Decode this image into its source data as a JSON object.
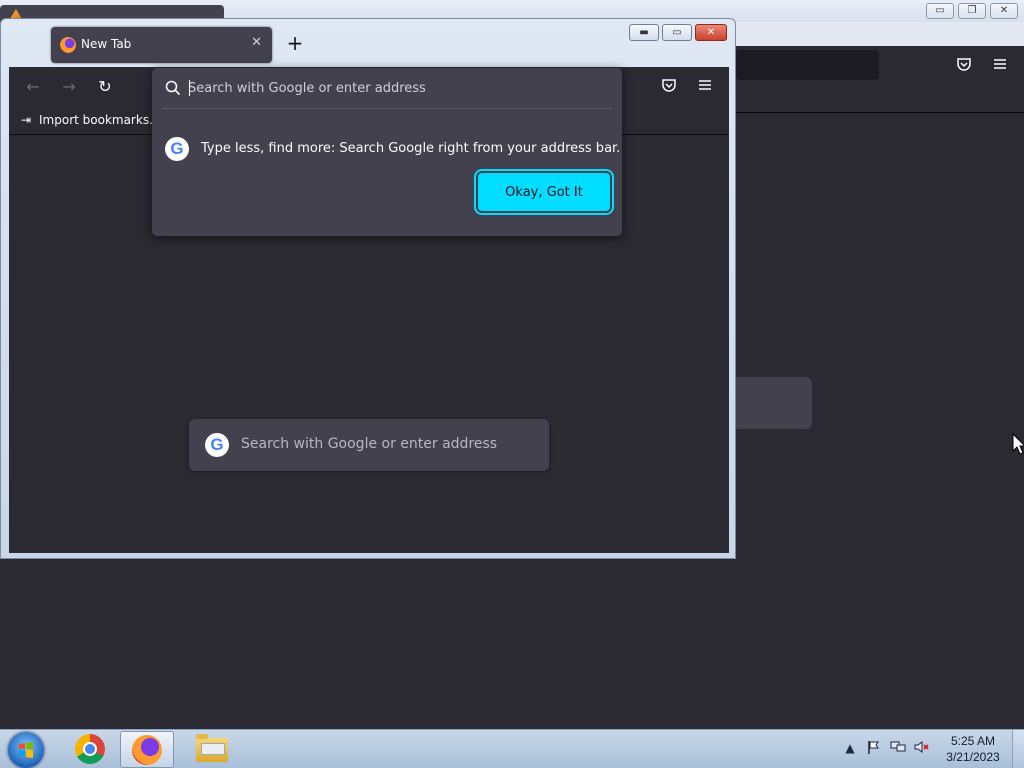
{
  "background_window": {
    "controls": {
      "minimize": "▭",
      "restore": "❐",
      "close": "✕"
    },
    "toolbar_icons": [
      "pocket-icon",
      "menu-icon"
    ]
  },
  "browser": {
    "tab": {
      "title": "New Tab",
      "close": "✕"
    },
    "new_tab": "+",
    "window_controls": {
      "minimize": "▬",
      "maximize": "▭",
      "close": "✕"
    },
    "nav": {
      "back": "←",
      "forward": "→",
      "reload": "↻"
    },
    "toolbar_icons": {
      "pocket": "⛉",
      "menu": "≡"
    },
    "bookmarks_bar": {
      "import_label": "Import bookmarks..."
    },
    "urlbar": {
      "placeholder": "Search with Google or enter address",
      "tip_text": "Type less, find more: Search Google right from your address bar.",
      "tip_button": "Okay, Got It"
    },
    "content_search": {
      "placeholder": "Search with Google or enter address"
    }
  },
  "taskbar": {
    "apps": [
      "Google Chrome",
      "Firefox",
      "Windows Explorer"
    ],
    "tray": {
      "show_hidden": "▲"
    },
    "clock": {
      "time": "5:25 AM",
      "date": "3/21/2023"
    }
  },
  "colors": {
    "accent": "#00ddff",
    "browser_bg": "#2b2a33",
    "popup_bg": "#42414d"
  }
}
